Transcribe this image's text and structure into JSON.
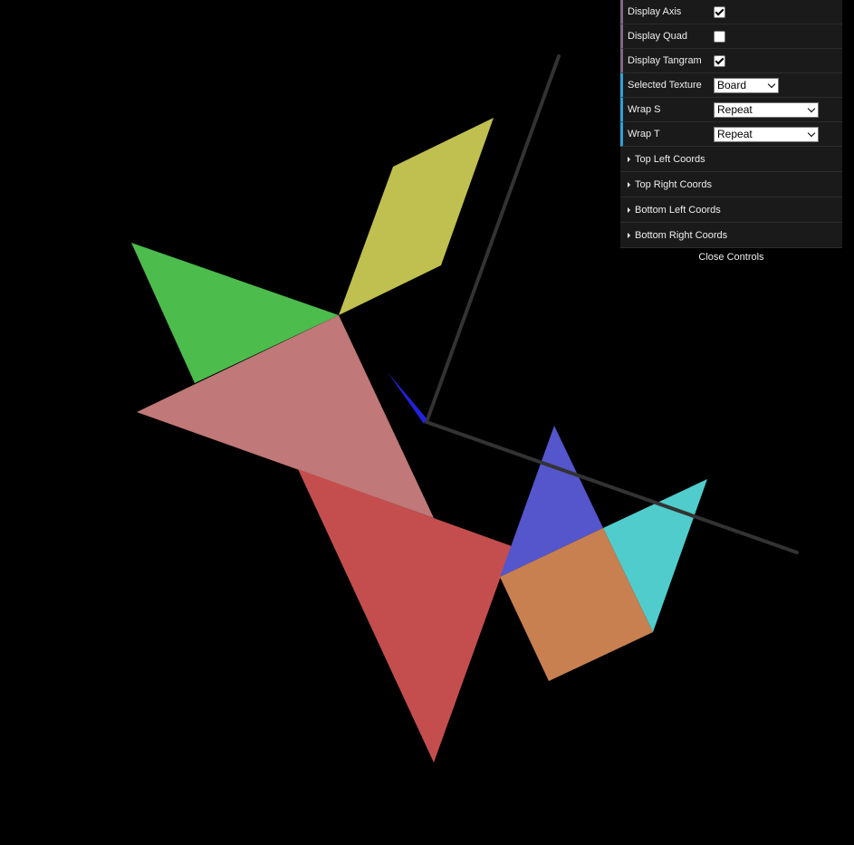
{
  "controls": {
    "display_axis": {
      "label": "Display Axis",
      "checked": true
    },
    "display_quad": {
      "label": "Display Quad",
      "checked": false
    },
    "display_tangram": {
      "label": "Display Tangram",
      "checked": true
    },
    "selected_texture": {
      "label": "Selected Texture",
      "value": "Board"
    },
    "wrap_s": {
      "label": "Wrap S",
      "value": "Repeat"
    },
    "wrap_t": {
      "label": "Wrap T",
      "value": "Repeat"
    }
  },
  "folders": {
    "top_left": "Top Left Coords",
    "top_right": "Top Right Coords",
    "bottom_left": "Bottom Left Coords",
    "bottom_right": "Bottom Right Coords"
  },
  "close_label": "Close Controls",
  "colors": {
    "background": "#000000",
    "panel_bg": "#1a1a1a",
    "boolean_accent": "#806787",
    "select_accent": "#2fa1d6",
    "yellow_piece": "#c0c050",
    "green_piece": "#4cbc4c",
    "pink_piece": "#c07878",
    "red_piece": "#c44e4e",
    "blue_piece": "#5555cc",
    "cyan_piece": "#50cccc",
    "orange_piece": "#c88050",
    "axis_line": "#333333",
    "axis_blue": "#2222dd"
  }
}
